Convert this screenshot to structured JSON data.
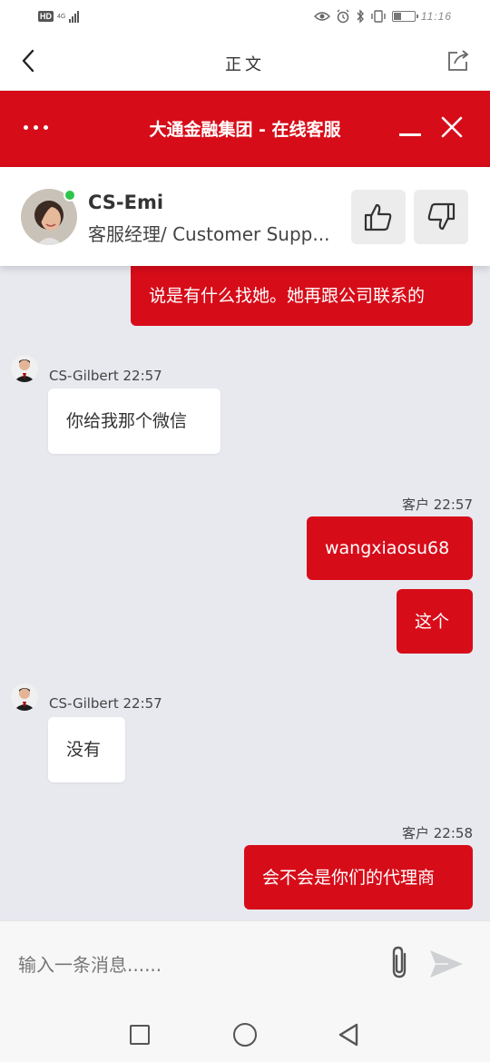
{
  "status_bar": {
    "hd_badge": "HD",
    "network": "4G",
    "time": "11:16",
    "battery_level": 0.35
  },
  "app_bar": {
    "title": "正文",
    "back_icon": "chevron-left-icon",
    "share_icon": "share-icon"
  },
  "chat_header": {
    "title": "大通金融集团 - 在线客服",
    "menu_icon": "more-dots-icon",
    "minimize_icon": "minimize-icon",
    "close_icon": "close-icon",
    "brand_color": "#d70c19"
  },
  "agent": {
    "name": "CS-Emi",
    "role": "客服经理/ Customer Supp...",
    "status": "online",
    "status_color": "#2ec44a",
    "thumbs_up_icon": "thumbs-up-icon",
    "thumbs_down_icon": "thumbs-down-icon"
  },
  "messages": [
    {
      "direction": "out",
      "text": "说是有什么找她。她再跟公司联系的"
    },
    {
      "direction": "in",
      "sender": "CS-Gilbert 22:57",
      "text": "你给我那个微信"
    },
    {
      "direction": "out",
      "sender": "客户 22:57",
      "text": "wangxiaosu68"
    },
    {
      "direction": "out",
      "text": "这个"
    },
    {
      "direction": "in",
      "sender": "CS-Gilbert 22:57",
      "text": "没有"
    },
    {
      "direction": "out",
      "sender": "客户 22:58",
      "text": "会不会是你们的代理商"
    }
  ],
  "composer": {
    "placeholder": "输入一条消息......",
    "attach_icon": "paperclip-icon",
    "send_icon": "send-icon"
  },
  "nav_bar": {
    "recents_icon": "square-icon",
    "home_icon": "circle-icon",
    "back_icon": "triangle-back-icon"
  }
}
